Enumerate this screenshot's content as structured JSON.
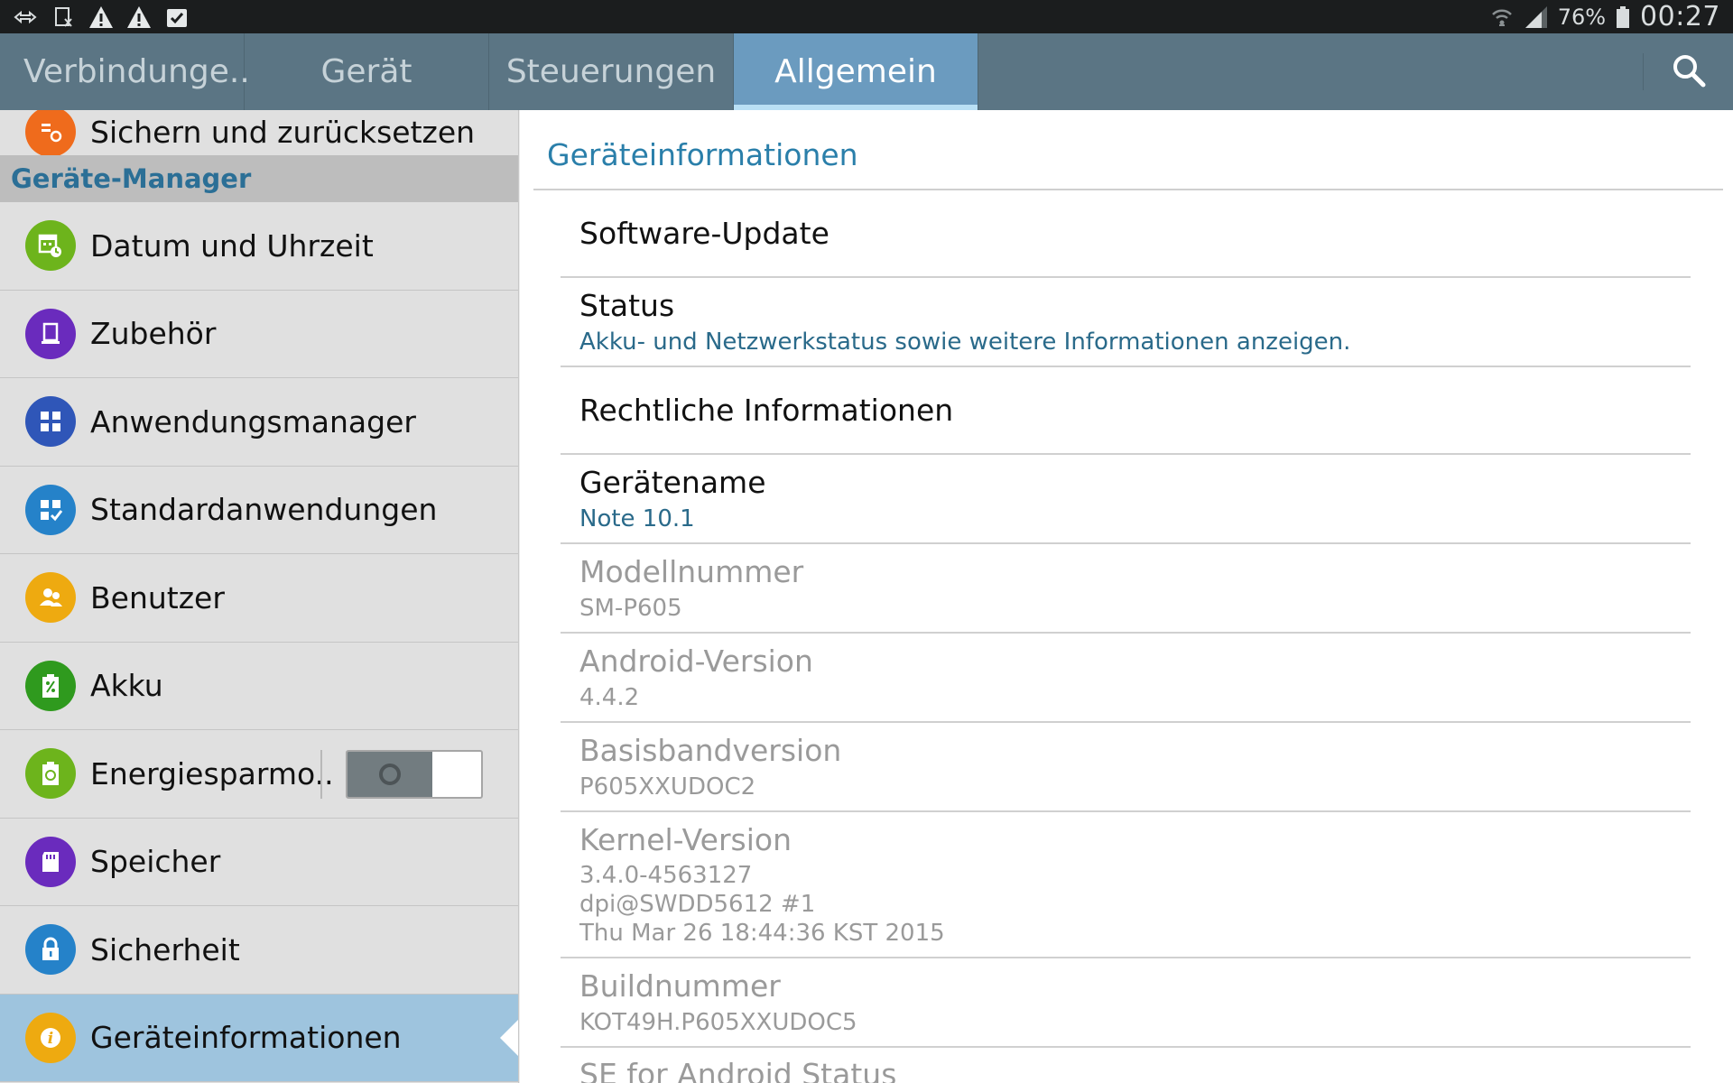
{
  "statusbar": {
    "battery_text": "76%",
    "time": "00:27",
    "left_icons": [
      "usb-icon",
      "screenshot-icon",
      "warning-icon",
      "warning-icon",
      "clipboard-check-icon"
    ],
    "right_icons": [
      "wifi-icon",
      "signal-icon",
      "battery-icon"
    ]
  },
  "tabs": [
    {
      "label": "Verbindunge.."
    },
    {
      "label": "Gerät"
    },
    {
      "label": "Steuerungen"
    },
    {
      "label": "Allgemein"
    }
  ],
  "search": {
    "icon": "search-icon"
  },
  "sidebar": {
    "partial_item": "Sichern und zurücksetzen",
    "section_header": "Geräte-Manager",
    "items": [
      {
        "label": "Datum und Uhrzeit",
        "icon": "calendar-clock-icon",
        "color": "#6db41c"
      },
      {
        "label": "Zubehör",
        "icon": "accessory-icon",
        "color": "#6a2bbd"
      },
      {
        "label": "Anwendungsmanager",
        "icon": "grid-icon",
        "color": "#2f56b8"
      },
      {
        "label": "Standardanwendungen",
        "icon": "grid-check-icon",
        "color": "#2582c9"
      },
      {
        "label": "Benutzer",
        "icon": "users-icon",
        "color": "#eeaa10"
      },
      {
        "label": "Akku",
        "icon": "battery-percent-icon",
        "color": "#2f9a1e"
      },
      {
        "label": "Energiesparmo..",
        "icon": "recycle-icon",
        "color": "#6db41c",
        "toggle": "off"
      },
      {
        "label": "Speicher",
        "icon": "sd-card-icon",
        "color": "#6a2bbd"
      },
      {
        "label": "Sicherheit",
        "icon": "lock-icon",
        "color": "#2582c9"
      },
      {
        "label": "Geräteinformationen",
        "icon": "info-icon",
        "color": "#eeaa10"
      }
    ]
  },
  "detail": {
    "header": "Geräteinformationen",
    "rows": [
      {
        "title": "Software-Update",
        "sub": []
      },
      {
        "title": "Status",
        "sub": [
          "Akku- und Netzwerkstatus sowie weitere Informationen anzeigen."
        ]
      },
      {
        "title": "Rechtliche Informationen",
        "sub": []
      },
      {
        "title": "Gerätename",
        "sub": [
          "Note 10.1"
        ]
      },
      {
        "title": "Modellnummer",
        "sub": [
          "SM-P605"
        ]
      },
      {
        "title": "Android-Version",
        "sub": [
          "4.4.2"
        ]
      },
      {
        "title": "Basisbandversion",
        "sub": [
          "P605XXUDOC2"
        ]
      },
      {
        "title": "Kernel-Version",
        "sub": [
          "3.4.0-4563127",
          "dpi@SWDD5612 #1",
          "Thu Mar 26 18:44:36 KST 2015"
        ]
      },
      {
        "title": "Buildnummer",
        "sub": [
          "KOT49H.P605XXUDOC5"
        ]
      },
      {
        "title": "SE for Android Status",
        "sub": []
      }
    ]
  }
}
